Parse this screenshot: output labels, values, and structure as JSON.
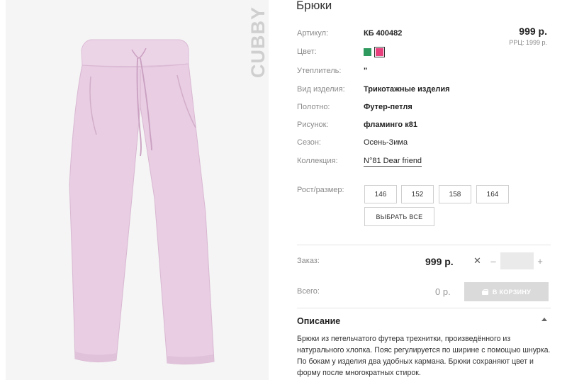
{
  "product": {
    "title": "Брюки",
    "brand": "CUBBY",
    "price": "999 р.",
    "rrp": "РРЦ: 1999 р."
  },
  "attributes": [
    {
      "label": "Артикул:",
      "value": "КБ 400482"
    },
    {
      "label": "Цвет:",
      "value": ""
    },
    {
      "label": "Утеплитель:",
      "value": "\""
    },
    {
      "label": "Вид изделия:",
      "value": "Трикотажные изделия"
    },
    {
      "label": "Полотно:",
      "value": "Футер-петля"
    },
    {
      "label": "Рисунок:",
      "value": "фламинго к81"
    },
    {
      "label": "Сезон:",
      "value": "Осень-Зима"
    },
    {
      "label": "Коллекция:",
      "value": "N°81 Dear friend"
    }
  ],
  "colors": [
    {
      "name": "green",
      "hex": "#2e9a5d"
    },
    {
      "name": "pink",
      "hex": "#e8407c",
      "selected": true
    }
  ],
  "sizes": {
    "label": "Рост/размер:",
    "options": [
      "146",
      "152",
      "158",
      "164"
    ],
    "select_all": "ВЫБРАТЬ ВСЕ"
  },
  "order": {
    "label": "Заказ:",
    "price": "999 р.",
    "times": "✕",
    "minus": "–",
    "plus": "+",
    "quantity": ""
  },
  "total": {
    "label": "Всего:",
    "value": "0 р.",
    "cart_button": "В КОРЗИНУ"
  },
  "description": {
    "heading": "Описание",
    "text": "Брюки из петельчатого футера трехнитки, произведённого из натурального хлопка. Пояс регулируется по ширине с помощью шнурка. По бокам у изделия два удобных кармана. Брюки сохраняют цвет и форму после многократных стирок."
  },
  "theme": {
    "product_color": "#e8cde3",
    "cart_button_bg": "#dadada"
  }
}
